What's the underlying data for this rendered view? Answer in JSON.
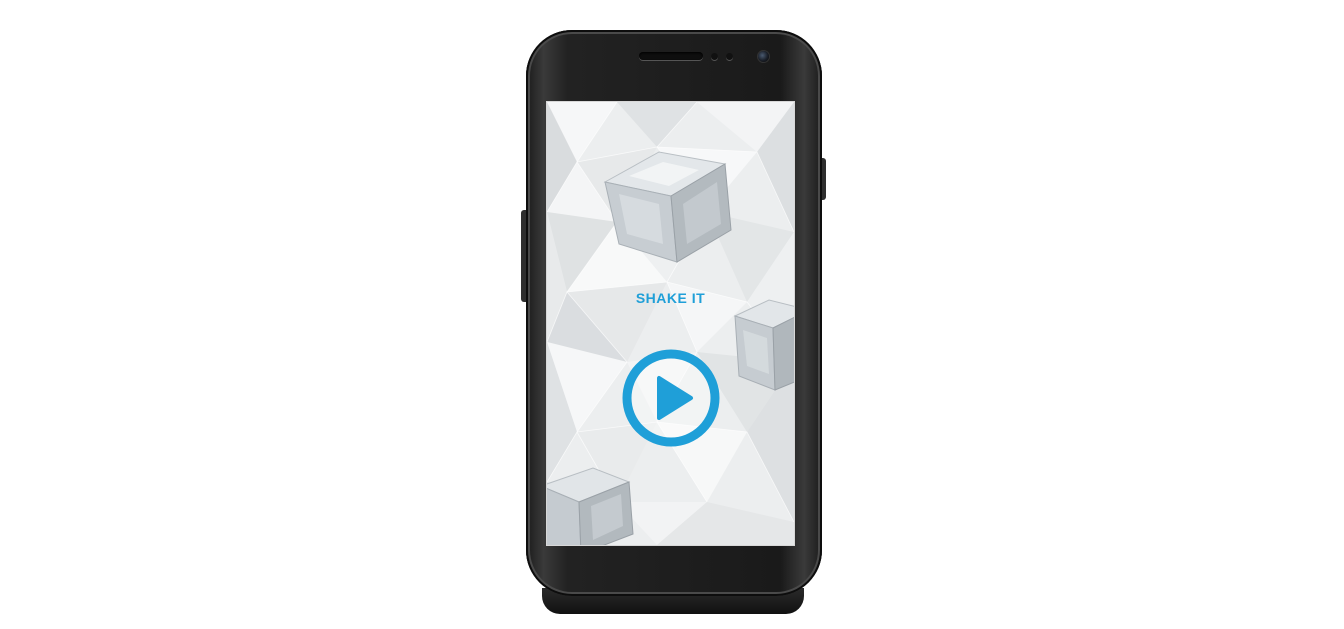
{
  "screen": {
    "title": "SHAKE IT",
    "play_button": {
      "icon": "play-icon",
      "color": "#1f9fd8"
    }
  },
  "decorations": {
    "background": "ice-crystal-pattern",
    "ice_cubes": [
      "ice-cube-icon",
      "ice-cube-icon",
      "ice-cube-icon"
    ]
  },
  "colors": {
    "accent": "#1f9fd8",
    "phone_body": "#1e1e1e"
  }
}
